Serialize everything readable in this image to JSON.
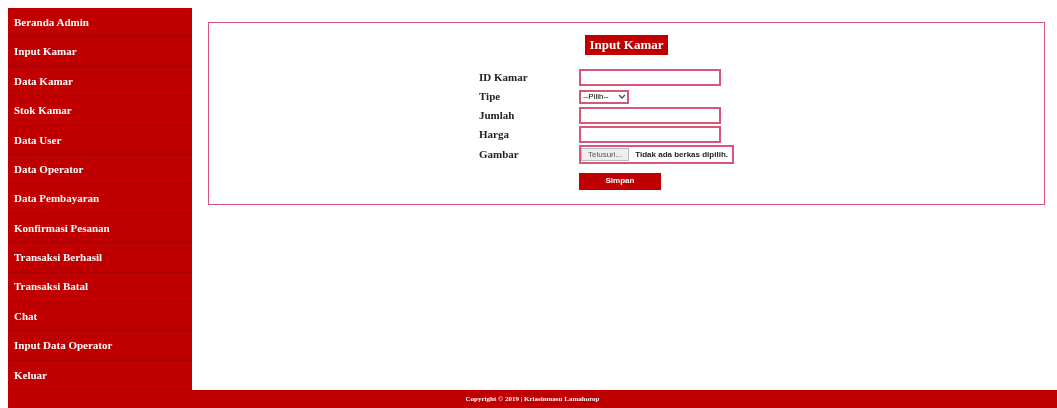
{
  "sidebar": {
    "items": [
      {
        "label": "Beranda Admin"
      },
      {
        "label": "Input Kamar"
      },
      {
        "label": "Data Kamar"
      },
      {
        "label": "Stok Kamar"
      },
      {
        "label": "Data User"
      },
      {
        "label": "Data Operator"
      },
      {
        "label": "Data Pembayaran"
      },
      {
        "label": "Konfirmasi Pesanan"
      },
      {
        "label": "Transaksi Berhasil"
      },
      {
        "label": "Transaksi Batal"
      },
      {
        "label": "Chat"
      },
      {
        "label": "Input Data Operator"
      },
      {
        "label": "Keluar"
      }
    ]
  },
  "form": {
    "title": "Input Kamar",
    "fields": [
      {
        "kind": "text",
        "label": "ID Kamar"
      },
      {
        "kind": "select",
        "label": "Tipe",
        "value": "--Pilih--"
      },
      {
        "kind": "text",
        "label": "Jumlah"
      },
      {
        "kind": "text",
        "label": "Harga"
      },
      {
        "kind": "file",
        "label": "Gambar",
        "button": "Telusuri...",
        "value": "Tidak ada berkas dipilih."
      }
    ],
    "submit": "Simpan"
  },
  "footer": "Copyright © 2019 | Kriasinmasu Lamahorop"
}
